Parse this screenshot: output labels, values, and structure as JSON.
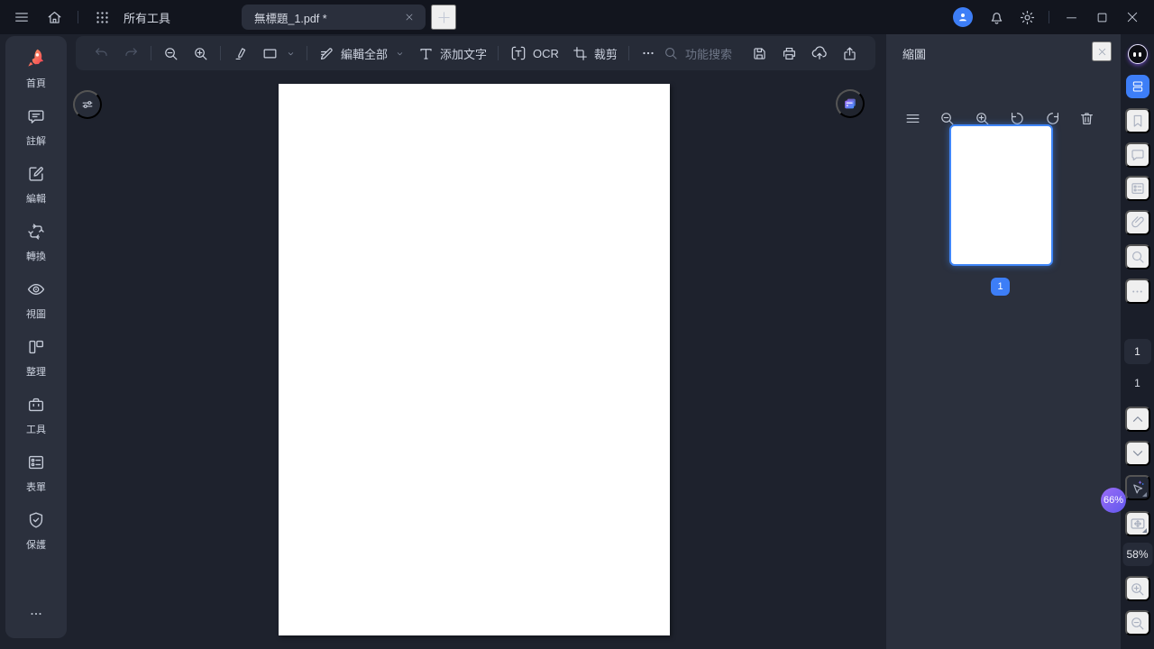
{
  "titlebar": {
    "all_tools": "所有工具",
    "tab_title": "無標題_1.pdf *"
  },
  "toolbar": {
    "edit_all": "編輯全部",
    "add_text": "添加文字",
    "ocr": "OCR",
    "crop": "裁剪",
    "search_placeholder": "功能搜索"
  },
  "left_sidebar": {
    "items": [
      {
        "label": "首頁",
        "icon": "rocket-icon"
      },
      {
        "label": "註解",
        "icon": "comment-icon"
      },
      {
        "label": "編輯",
        "icon": "edit-icon"
      },
      {
        "label": "轉換",
        "icon": "convert-icon"
      },
      {
        "label": "視圖",
        "icon": "view-eye-icon"
      },
      {
        "label": "整理",
        "icon": "organize-icon"
      },
      {
        "label": "工具",
        "icon": "toolbox-icon"
      },
      {
        "label": "表單",
        "icon": "form-icon"
      },
      {
        "label": "保護",
        "icon": "shield-icon"
      }
    ]
  },
  "thumbnail_panel": {
    "title": "縮圖",
    "page_badge": "1"
  },
  "right_rail": {
    "page_current": "1",
    "page_total": "1",
    "pointer_zoom_badge": "66%",
    "zoom_level": "58%"
  },
  "colors": {
    "accent_blue": "#3d7ef7",
    "thumbnail_border": "#3f86f8",
    "badge_purple_gradient": [
      "#9a6cf6",
      "#6158ee"
    ],
    "titlebar_bg": "#12151e",
    "panel_bg": "#2b303d",
    "toolbar_bg": "#262b37",
    "canvas_bg": "#1e222d",
    "right_rail_bg": "#1a1e29"
  }
}
